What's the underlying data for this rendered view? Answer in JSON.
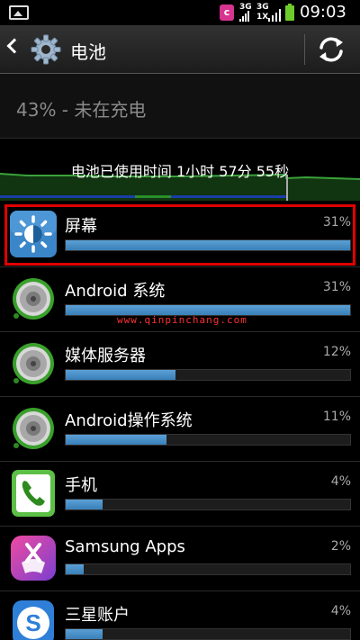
{
  "status_bar": {
    "time": "09:03",
    "carrier_badge": "c",
    "network_1": "3G",
    "network_2": "3G",
    "network_2_sub": "1X",
    "battery_color": "#6ecb2c"
  },
  "header": {
    "title": "电池",
    "back_icon": "chevron-left-icon",
    "app_icon": "gear-icon",
    "refresh_icon": "refresh-icon"
  },
  "summary": {
    "text": "43% - 未在充电"
  },
  "graph": {
    "label": "电池已使用时间 1小时 57分 55秒"
  },
  "watermark": "www.qinpinchang.com",
  "list": [
    {
      "name": "屏幕",
      "percent": "31%",
      "fraction": 0.31,
      "icon": "screen-brightness-icon",
      "highlighted": true
    },
    {
      "name": "Android 系统",
      "percent": "31%",
      "fraction": 0.31,
      "icon": "android-system-icon"
    },
    {
      "name": "媒体服务器",
      "percent": "12%",
      "fraction": 0.12,
      "icon": "media-server-icon"
    },
    {
      "name": "Android操作系统",
      "percent": "11%",
      "fraction": 0.11,
      "icon": "android-os-icon"
    },
    {
      "name": "手机",
      "percent": "4%",
      "fraction": 0.04,
      "icon": "phone-icon"
    },
    {
      "name": "Samsung Apps",
      "percent": "2%",
      "fraction": 0.02,
      "icon": "samsung-apps-icon"
    },
    {
      "name": "三星账户",
      "percent": "4%",
      "fraction": 0.04,
      "icon": "samsung-account-icon"
    }
  ],
  "colors": {
    "bar": "#4a90c8",
    "highlight": "#e00000",
    "accent_green": "#4caf35"
  }
}
